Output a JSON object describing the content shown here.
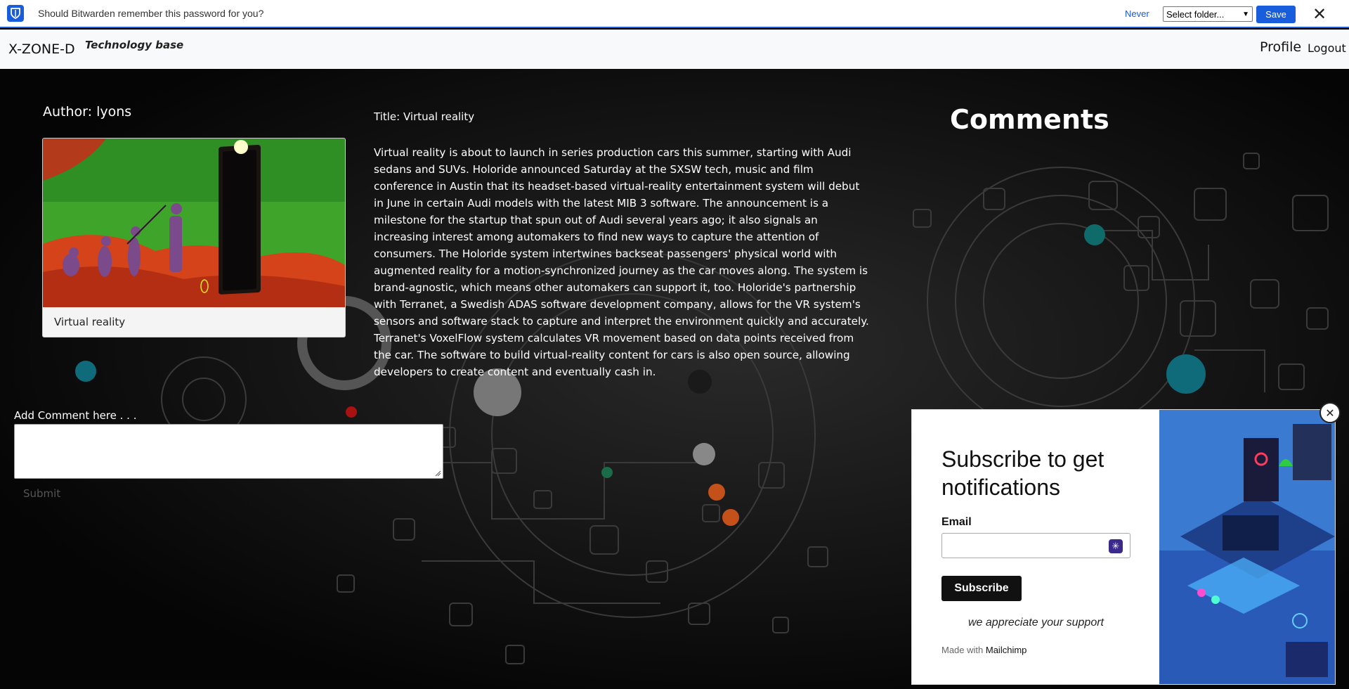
{
  "bitwarden": {
    "message": "Should Bitwarden remember this password for you?",
    "never_label": "Never",
    "folder_select": "Select folder...",
    "save_label": "Save",
    "close_glyph": "✕"
  },
  "navbar": {
    "brand": "X-ZONE-D",
    "tagline": "Technology base",
    "profile": "Profile",
    "logout": "Logout"
  },
  "article": {
    "author": "Author: lyons",
    "card_caption": "Virtual reality",
    "title": "Title: Virtual reality",
    "body": "Virtual reality is about to launch in series production cars this summer, starting with Audi sedans and SUVs. Holoride announced Saturday at the SXSW tech, music and film conference in Austin that its headset-based virtual-reality entertainment system will debut in June in certain Audi models with the latest MIB 3 software. The announcement is a milestone for the startup that spun out of Audi several years ago; it also signals an increasing interest among automakers to find new ways to capture the attention of consumers. The Holoride system intertwines backseat passengers' physical world with augmented reality for a motion-synchronized journey as the car moves along. The system is brand-agnostic, which means other automakers can support it, too. Holoride's partnership with Terranet, a Swedish ADAS software development company, allows for the VR system's sensors and software stack to capture and interpret the environment quickly and accurately. Terranet's VoxelFlow system calculates VR movement based on data points received from the car. The software to build virtual-reality content for cars is also open source, allowing developers to create content and eventually cash in."
  },
  "comments": {
    "heading": "Comments",
    "add_label": "Add Comment here . . .",
    "submit_label": "Submit"
  },
  "popup": {
    "heading": "Subscribe to get notifications",
    "email_label": "Email",
    "subscribe_label": "Subscribe",
    "appreciate": "we appreciate your support",
    "made_with": "Made with",
    "made_with_brand": "Mailchimp",
    "close_glyph": "✕"
  },
  "colors": {
    "bitwarden_blue": "#175ddc",
    "page_bg": "#050505",
    "navbar_bg": "#f8f9fa"
  }
}
